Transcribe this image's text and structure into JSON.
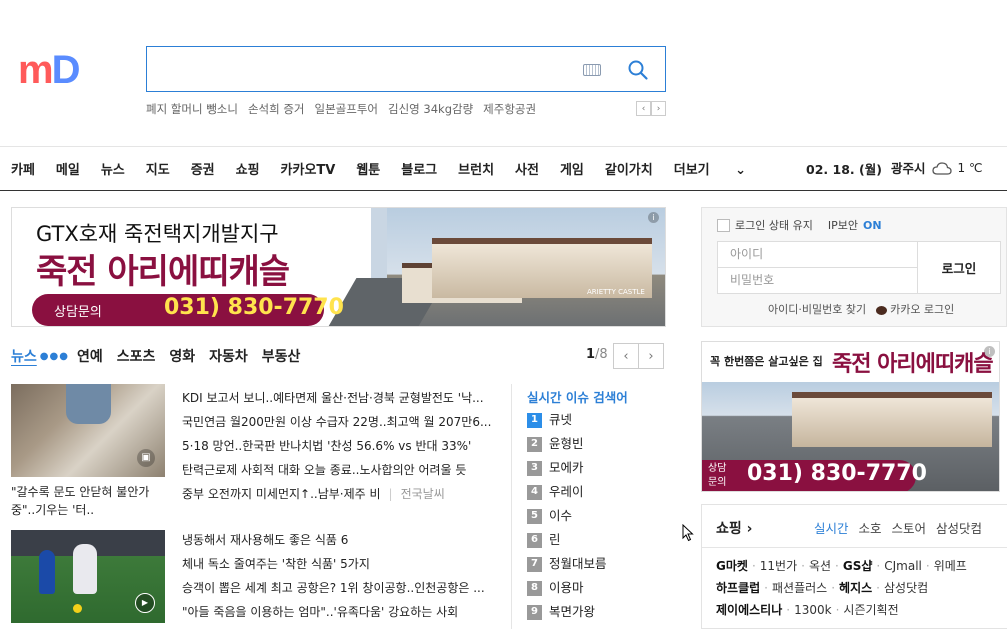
{
  "logo": {
    "part1": "m",
    "part2": "D"
  },
  "search": {
    "value": "",
    "placeholder": ""
  },
  "hot_keywords": [
    "폐지 할머니 뺑소니",
    "손석희 증거",
    "일본골프투어",
    "김신영 34kg감량",
    "제주항공권"
  ],
  "keyword_nav": {
    "prev": "‹",
    "next": "›"
  },
  "gnb": [
    "카페",
    "메일",
    "뉴스",
    "지도",
    "증권",
    "쇼핑",
    "카카오TV",
    "웹툰",
    "블로그",
    "브런치",
    "사전",
    "게임",
    "같이가치",
    "더보기"
  ],
  "date": "02. 18. (월)",
  "weather": {
    "city": "광주시",
    "temp": "1 ℃",
    "icon": "cloud-icon"
  },
  "banner": {
    "line1": "GTX호재 죽전택지개발지구",
    "line2": "죽전 아리에띠캐슬",
    "cta_label": "상담문의",
    "cta_phone": "031) 830-7770",
    "brand": "ARIETTY CASTLE",
    "info": "i"
  },
  "news_tabs": {
    "active": "뉴스",
    "tabs": [
      "연예",
      "스포츠",
      "영화",
      "자동차",
      "부동산"
    ]
  },
  "pager": {
    "current": "1",
    "total": "/8"
  },
  "news": {
    "caption1": "\"갈수록 문도 안닫혀 불안가중\"..기우는 '터..",
    "group1": [
      "KDI 보고서 보니..예타면제 울산·전남·경북 균형발전도 '낙...",
      "국민연금 월200만원 이상 수급자 22명..최고액 월 207만6...",
      "5·18 망언..한국판 반나치법 '찬성 56.6% vs 반대 33%'",
      "탄력근로제 사회적 대화 오늘 종료..노사합의안 어려울 듯"
    ],
    "dust": "중부 오전까지 미세먼지↑..남부·제주 비",
    "dust_sub": "전국날씨",
    "group2": [
      "냉동해서 재사용해도 좋은 식품 6",
      "체내 독소 줄여주는 '착한 식품' 5가지",
      "승객이 뽑은 세계 최고 공항은? 1위 창이공항..인천공항은 ...",
      "\"아들 죽음을 이용하는 엄마\"..'유족다움' 강요하는 사회"
    ]
  },
  "realtime": {
    "title": "실시간 이슈 검색어",
    "items": [
      {
        "rank": "1",
        "word": "큐넷"
      },
      {
        "rank": "2",
        "word": "윤형빈"
      },
      {
        "rank": "3",
        "word": "모에카"
      },
      {
        "rank": "4",
        "word": "우레이"
      },
      {
        "rank": "5",
        "word": "이수"
      },
      {
        "rank": "6",
        "word": "린"
      },
      {
        "rank": "7",
        "word": "정월대보름"
      },
      {
        "rank": "8",
        "word": "이용마"
      },
      {
        "rank": "9",
        "word": "복면가왕"
      }
    ]
  },
  "login": {
    "keep": "로그인 상태 유지",
    "ip": "IP보안",
    "ip_state": "ON",
    "id_placeholder": "아이디",
    "pw_placeholder": "비밀번호",
    "button": "로그인",
    "find": "아이디·비밀번호 찾기",
    "kakao": "카카오 로그인"
  },
  "ad2": {
    "head1": "꼭 한번쯤은 살고싶은 집",
    "head2": "죽전 아리에띠캐슬",
    "cta_label": "상담\n문의",
    "cta_phone": "031) 830-7770",
    "info": "i"
  },
  "shopping": {
    "title": "쇼핑 ›",
    "tabs": [
      "실시간",
      "소호",
      "스토어",
      "삼성닷컴"
    ],
    "row1": [
      "G마켓",
      "11번가",
      "옥션",
      "GS샵",
      "CJmall",
      "위메프"
    ],
    "row2": [
      "하프클럽",
      "패션플러스",
      "헤지스",
      "삼성닷컴"
    ],
    "row3": [
      "제이에스티나",
      "1300k",
      "시즌기획전"
    ]
  },
  "colors": {
    "accent": "#2c7fd6",
    "brand_red": "#ff5a5a",
    "brand_blue": "#5a8cff",
    "ad": "#8a1040"
  }
}
